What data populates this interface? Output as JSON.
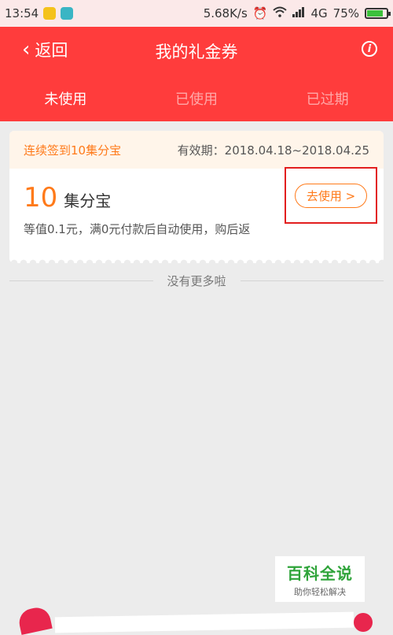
{
  "status_bar": {
    "time": "13:54",
    "network_speed": "5.68K/s",
    "network_type": "4G",
    "battery": "75%",
    "battery_level": 0.75
  },
  "header": {
    "back_label": "返回",
    "title": "我的礼金券",
    "tabs": [
      {
        "label": "未使用",
        "active": true
      },
      {
        "label": "已使用",
        "active": false
      },
      {
        "label": "已过期",
        "active": false
      }
    ]
  },
  "coupon": {
    "source": "连续签到10集分宝",
    "validity": "有效期：2018.04.18~2018.04.25",
    "amount": "10",
    "unit": "集分宝",
    "description": "等值0.1元，满0元付款后自动使用，购后返",
    "use_button": "去使用 >"
  },
  "footer_text": "没有更多啦",
  "watermark": {
    "title": "百科全说",
    "subtitle": "助你轻松解决"
  },
  "colors": {
    "header_red": "#ff3c3c",
    "accent_orange": "#ff7a1a",
    "highlight_red": "#e21e1e",
    "watermark_green": "#2fa43a"
  }
}
